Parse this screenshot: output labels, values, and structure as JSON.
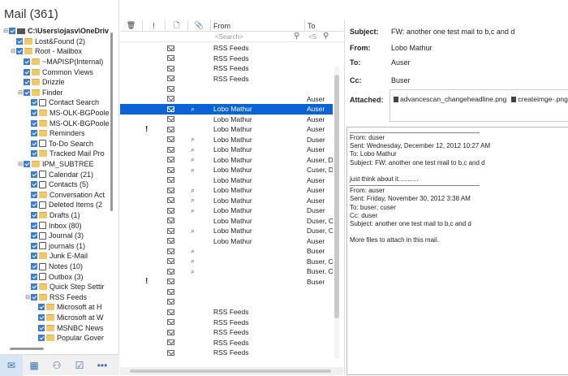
{
  "app": {
    "title": "Mail (361)"
  },
  "tree": [
    {
      "label": "C:\\Users\\ojasv\\OneDriv",
      "level": 0,
      "exp": "▢",
      "icon": "drive",
      "bold": true
    },
    {
      "label": "Lost&Found (2)",
      "level": 1,
      "exp": "",
      "icon": "folder"
    },
    {
      "label": "Root - Mailbox",
      "level": 1,
      "exp": "▢",
      "icon": "folder"
    },
    {
      "label": "~MAPISP(Internal)",
      "level": 2,
      "exp": "",
      "icon": "folder"
    },
    {
      "label": "Common Views",
      "level": 2,
      "exp": "",
      "icon": "folder"
    },
    {
      "label": "Drizzle",
      "level": 2,
      "exp": "",
      "icon": "folder"
    },
    {
      "label": "Finder",
      "level": 2,
      "exp": "▢",
      "icon": "folder"
    },
    {
      "label": "Contact Search",
      "level": 3,
      "exp": "",
      "icon": "special"
    },
    {
      "label": "MS-OLK-BGPoole",
      "level": 3,
      "exp": "",
      "icon": "folder"
    },
    {
      "label": "MS-OLK-BGPoole",
      "level": 3,
      "exp": "",
      "icon": "folder"
    },
    {
      "label": "Reminders",
      "level": 3,
      "exp": "",
      "icon": "folder"
    },
    {
      "label": "To-Do Search",
      "level": 3,
      "exp": "",
      "icon": "special"
    },
    {
      "label": "Tracked Mail Pro",
      "level": 3,
      "exp": "",
      "icon": "folder"
    },
    {
      "label": "IPM_SUBTREE",
      "level": 2,
      "exp": "▢",
      "icon": "folder"
    },
    {
      "label": "Calendar (21)",
      "level": 3,
      "exp": "",
      "icon": "special"
    },
    {
      "label": "Contacts (5)",
      "level": 3,
      "exp": "",
      "icon": "special"
    },
    {
      "label": "Conversation Act",
      "level": 3,
      "exp": "",
      "icon": "folder"
    },
    {
      "label": "Deleted Items (2",
      "level": 3,
      "exp": "",
      "icon": "special"
    },
    {
      "label": "Drafts (1)",
      "level": 3,
      "exp": "",
      "icon": "folder"
    },
    {
      "label": "Inbox (80)",
      "level": 3,
      "exp": "",
      "icon": "special"
    },
    {
      "label": "Journal (3)",
      "level": 3,
      "exp": "",
      "icon": "special"
    },
    {
      "label": "journals (1)",
      "level": 3,
      "exp": "",
      "icon": "special"
    },
    {
      "label": "Junk E-Mail",
      "level": 3,
      "exp": "",
      "icon": "folder"
    },
    {
      "label": "Notes (10)",
      "level": 3,
      "exp": "",
      "icon": "special"
    },
    {
      "label": "Outbox (3)",
      "level": 3,
      "exp": "",
      "icon": "special"
    },
    {
      "label": "Quick Step Settir",
      "level": 3,
      "exp": "",
      "icon": "folder"
    },
    {
      "label": "RSS Feeds",
      "level": 3,
      "exp": "▢",
      "icon": "folder"
    },
    {
      "label": "Microsoft at H",
      "level": 4,
      "exp": "",
      "icon": "folder"
    },
    {
      "label": "Microsoft at W",
      "level": 4,
      "exp": "",
      "icon": "folder"
    },
    {
      "label": "MSNBC News",
      "level": 4,
      "exp": "",
      "icon": "folder"
    },
    {
      "label": "Popular Gover",
      "level": 4,
      "exp": "",
      "icon": "folder"
    }
  ],
  "nav": [
    {
      "icon": "mail-icon",
      "glyph": "✉"
    },
    {
      "icon": "calendar-icon",
      "glyph": "▦"
    },
    {
      "icon": "people-icon",
      "glyph": "⚇"
    },
    {
      "icon": "tasks-icon",
      "glyph": "☑"
    },
    {
      "icon": "more-icon",
      "glyph": "•••"
    }
  ],
  "list": {
    "headers": {
      "delete": "🗑",
      "importance": "!",
      "doc": "🗋",
      "attach": "📎",
      "from": "From",
      "to": "To"
    },
    "search_placeholder": "<Search>",
    "to_search_placeholder": "<S",
    "rows": [
      {
        "from": "RSS Feeds",
        "to": "",
        "imp": false,
        "att": false
      },
      {
        "from": "RSS Feeds",
        "to": "",
        "imp": false,
        "att": false
      },
      {
        "from": "RSS Feeds",
        "to": "",
        "imp": false,
        "att": false
      },
      {
        "from": "RSS Feeds",
        "to": "",
        "imp": false,
        "att": false
      },
      {
        "from": "",
        "to": "",
        "imp": false,
        "att": false
      },
      {
        "from": "",
        "to": "Auser",
        "imp": false,
        "att": false
      },
      {
        "from": "Lobo Mathur",
        "to": "Auser",
        "imp": false,
        "att": true,
        "sel": true
      },
      {
        "from": "Lobo Mathur",
        "to": "Auser",
        "imp": false,
        "att": false
      },
      {
        "from": "Lobo Mathur",
        "to": "Auser",
        "imp": true,
        "att": false
      },
      {
        "from": "Lobo Mathur",
        "to": "Duser",
        "imp": false,
        "att": true
      },
      {
        "from": "Lobo Mathur",
        "to": "Auser",
        "imp": false,
        "att": true
      },
      {
        "from": "Lobo Mathur",
        "to": "Auser, Du",
        "imp": false,
        "att": true
      },
      {
        "from": "Lobo Mathur",
        "to": "Cuser, Du",
        "imp": false,
        "att": true
      },
      {
        "from": "Lobo Mathur",
        "to": "Auser",
        "imp": false,
        "att": false
      },
      {
        "from": "Lobo Mathur",
        "to": "Auser",
        "imp": false,
        "att": true
      },
      {
        "from": "Lobo Mathur",
        "to": "Auser",
        "imp": false,
        "att": true
      },
      {
        "from": "Lobo Mathur",
        "to": "Duser",
        "imp": false,
        "att": true
      },
      {
        "from": "Lobo Mathur",
        "to": "Duser, Cu",
        "imp": false,
        "att": false
      },
      {
        "from": "Lobo Mathur",
        "to": "Duser, Cu",
        "imp": false,
        "att": true
      },
      {
        "from": "Lobo Mathur",
        "to": "Auser",
        "imp": false,
        "att": false
      },
      {
        "from": "",
        "to": "Buser",
        "imp": false,
        "att": true
      },
      {
        "from": "",
        "to": "Buser, Cu",
        "imp": false,
        "att": true
      },
      {
        "from": "",
        "to": "Buser, Cu",
        "imp": false,
        "att": true
      },
      {
        "from": "",
        "to": "Buser",
        "imp": true,
        "att": false
      },
      {
        "from": "",
        "to": "",
        "imp": false,
        "att": false
      },
      {
        "from": "",
        "to": "",
        "imp": false,
        "att": false
      },
      {
        "from": "RSS Feeds",
        "to": "",
        "imp": false,
        "att": false
      },
      {
        "from": "RSS Feeds",
        "to": "",
        "imp": false,
        "att": false
      },
      {
        "from": "RSS Feeds",
        "to": "",
        "imp": false,
        "att": false
      },
      {
        "from": "RSS Feeds",
        "to": "",
        "imp": false,
        "att": false
      },
      {
        "from": "RSS Feeds",
        "to": "",
        "imp": false,
        "att": false
      }
    ]
  },
  "preview": {
    "subject_label": "Subject:",
    "subject": "FW: another one test mail to b,c and d",
    "from_label": "From:",
    "from": "Lobo Mathur",
    "to_label": "To:",
    "to": "Auser",
    "cc_label": "Cc:",
    "cc": "Buser",
    "attached_label": "Attached:",
    "attachments": [
      "advancescan_changeheadline.png",
      "createimge-.png"
    ],
    "body": [
      {
        "sep": true
      },
      {
        "text": "From: duser"
      },
      {
        "text": "Sent: Wednesday, December 12, 2012 10:27 AM"
      },
      {
        "text": "To: Lobo Mathur"
      },
      {
        "text": "Subject: FW: another one test mail to b,c and d"
      },
      {
        "text": ""
      },
      {
        "text": "just think about it..........."
      },
      {
        "sep": true
      },
      {
        "text": "From: auser"
      },
      {
        "text": "Sent: Friday, November 30, 2012 3:38 AM"
      },
      {
        "text": "To: buser; cuser"
      },
      {
        "text": "Cc: duser"
      },
      {
        "text": "Subject: another one test mail to b,c and d"
      },
      {
        "text": ""
      },
      {
        "text": "More files to attach in this mail."
      }
    ]
  }
}
